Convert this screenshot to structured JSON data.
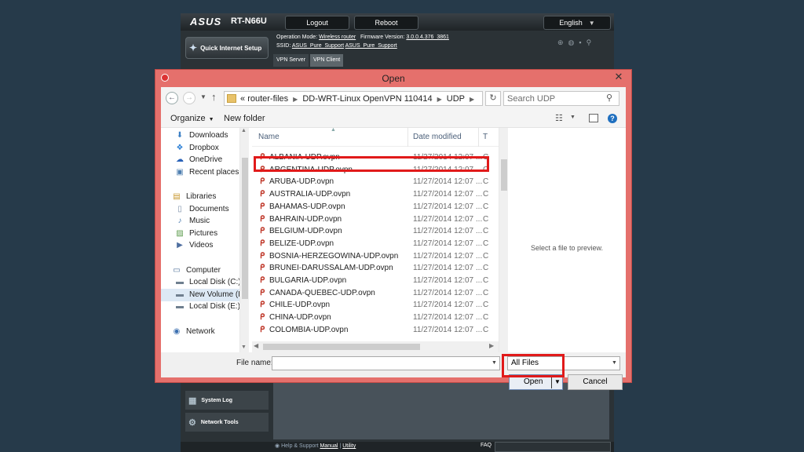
{
  "router": {
    "brand": "ASUS",
    "model": "RT-N66U",
    "logout_label": "Logout",
    "reboot_label": "Reboot",
    "language": "English",
    "quick_setup_label": "Quick Internet Setup",
    "operation_mode_label": "Operation Mode:",
    "operation_mode_value": "Wireless router",
    "firmware_label": "Firmware Version:",
    "firmware_value": "3.0.0.4.376_3861",
    "ssid_label": "SSID:",
    "ssid_value_1": "ASUS_Pure_Support",
    "ssid_value_2": "ASUS_Pure_Support",
    "tabs": [
      "VPN Server",
      "VPN Client"
    ],
    "side_items": [
      "System Log",
      "Network Tools"
    ],
    "footer_help": "Help & Support",
    "footer_manual": "Manual",
    "footer_utility": "Utility",
    "footer_faq": "FAQ"
  },
  "dialog": {
    "title": "Open",
    "close_glyph": "✕",
    "address": {
      "prefix": "«",
      "segments": [
        "router-files",
        "DD-WRT-Linux OpenVPN 110414",
        "UDP"
      ],
      "search_placeholder": "Search UDP"
    },
    "toolbar": {
      "organize_label": "Organize",
      "new_folder_label": "New folder"
    },
    "nav": [
      {
        "label": "Downloads",
        "icon": "downloads-icon",
        "glyph": "⬇",
        "color": "#3b7fc4",
        "top": false
      },
      {
        "label": "Dropbox",
        "icon": "dropbox-icon",
        "glyph": "❖",
        "color": "#2b7fd6",
        "top": false
      },
      {
        "label": "OneDrive",
        "icon": "onedrive-icon",
        "glyph": "☁",
        "color": "#2a62b8",
        "top": false
      },
      {
        "label": "Recent places",
        "icon": "recent-places-icon",
        "glyph": "▣",
        "color": "#4f7fb0",
        "top": false
      },
      {
        "label": "",
        "icon": "",
        "glyph": "",
        "color": "#000",
        "top": false
      },
      {
        "label": "Libraries",
        "icon": "libraries-icon",
        "glyph": "▤",
        "color": "#c7972e",
        "top": true
      },
      {
        "label": "Documents",
        "icon": "documents-icon",
        "glyph": "▯",
        "color": "#7a8ea6",
        "top": false
      },
      {
        "label": "Music",
        "icon": "music-icon",
        "glyph": "♪",
        "color": "#4f7fb0",
        "top": false
      },
      {
        "label": "Pictures",
        "icon": "pictures-icon",
        "glyph": "▨",
        "color": "#5a9a4a",
        "top": false
      },
      {
        "label": "Videos",
        "icon": "videos-icon",
        "glyph": "▶",
        "color": "#4f6fa0",
        "top": false
      },
      {
        "label": "",
        "icon": "",
        "glyph": "",
        "color": "#000",
        "top": false
      },
      {
        "label": "Computer",
        "icon": "computer-icon",
        "glyph": "▭",
        "color": "#4f6f9a",
        "top": true
      },
      {
        "label": "Local Disk (C:)",
        "icon": "disk-icon",
        "glyph": "▬",
        "color": "#6f7f8f",
        "top": false
      },
      {
        "label": "New Volume (D",
        "icon": "disk-icon",
        "glyph": "▬",
        "color": "#6f7f8f",
        "top": false,
        "selected": true
      },
      {
        "label": "Local Disk (E:)",
        "icon": "disk-icon",
        "glyph": "▬",
        "color": "#6f7f8f",
        "top": false
      },
      {
        "label": "",
        "icon": "",
        "glyph": "",
        "color": "#000",
        "top": false
      },
      {
        "label": "Network",
        "icon": "network-icon",
        "glyph": "◉",
        "color": "#3b6fb0",
        "top": true
      }
    ],
    "columns": {
      "name": "Name",
      "date": "Date modified",
      "type": "T"
    },
    "files": [
      {
        "name": "ALBANIA-UDP.ovpn",
        "date": "11/27/2014 12:07 ...",
        "type": "C"
      },
      {
        "name": "ARGENTINA-UDP.ovpn",
        "date": "11/27/2014 12:07 ...",
        "type": "C"
      },
      {
        "name": "ARUBA-UDP.ovpn",
        "date": "11/27/2014 12:07 ...",
        "type": "C"
      },
      {
        "name": "AUSTRALIA-UDP.ovpn",
        "date": "11/27/2014 12:07 ...",
        "type": "C"
      },
      {
        "name": "BAHAMAS-UDP.ovpn",
        "date": "11/27/2014 12:07 ...",
        "type": "C"
      },
      {
        "name": "BAHRAIN-UDP.ovpn",
        "date": "11/27/2014 12:07 ...",
        "type": "C"
      },
      {
        "name": "BELGIUM-UDP.ovpn",
        "date": "11/27/2014 12:07 ...",
        "type": "C"
      },
      {
        "name": "BELIZE-UDP.ovpn",
        "date": "11/27/2014 12:07 ...",
        "type": "C"
      },
      {
        "name": "BOSNIA-HERZEGOWINA-UDP.ovpn",
        "date": "11/27/2014 12:07 ...",
        "type": "C"
      },
      {
        "name": "BRUNEI-DARUSSALAM-UDP.ovpn",
        "date": "11/27/2014 12:07 ...",
        "type": "C"
      },
      {
        "name": "BULGARIA-UDP.ovpn",
        "date": "11/27/2014 12:07 ...",
        "type": "C"
      },
      {
        "name": "CANADA-QUEBEC-UDP.ovpn",
        "date": "11/27/2014 12:07 ...",
        "type": "C"
      },
      {
        "name": "CHILE-UDP.ovpn",
        "date": "11/27/2014 12:07 ...",
        "type": "C"
      },
      {
        "name": "CHINA-UDP.ovpn",
        "date": "11/27/2014 12:07 ...",
        "type": "C"
      },
      {
        "name": "COLOMBIA-UDP.ovpn",
        "date": "11/27/2014 12:07 ...",
        "type": "C"
      }
    ],
    "highlighted_file": "ARGENTINA-UDP.ovpn",
    "preview_text": "Select a file to preview.",
    "file_name_label": "File name:",
    "file_name_value": "",
    "filter_value": "All Files",
    "open_label": "Open",
    "cancel_label": "Cancel",
    "highlight_color": "#e11a1a"
  }
}
